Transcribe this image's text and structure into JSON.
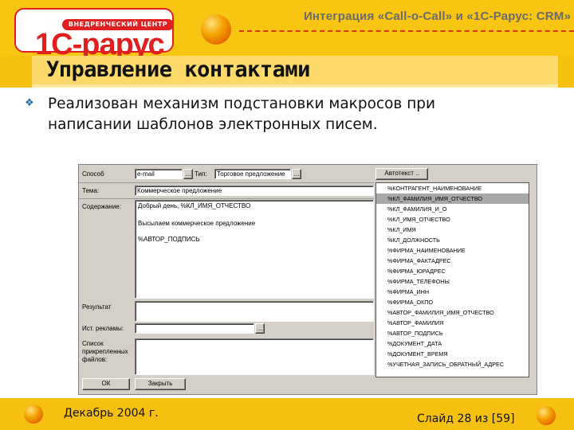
{
  "header": {
    "logo_tag": "ВНЕДРЕНЧЕСКИЙ ЦЕНТР",
    "logo_text": "1С-рарус",
    "title": "Интеграция «Call-o-Call» и «1С-Рарус: CRM»"
  },
  "slide": {
    "title": "Управление контактами",
    "bullet": "Реализован механизм подстановки макросов при написании шаблонов электронных писем."
  },
  "form": {
    "method_label": "Способ",
    "method_value": "e-mail",
    "type_label": "Тип:",
    "type_value": "Торговое предложение",
    "autotext_button": "Автотекст ..",
    "ellipsis": "...",
    "subject_label": "Тема:",
    "subject_value": "Коммерческое предложение",
    "content_label": "Содержание:",
    "body_lines": [
      "Добрый день, %КЛ_ИМЯ_ОТЧЕСТВО",
      "Высылаем коммерческое предложение",
      "%АВТОР_ПОДПИСЬ"
    ],
    "result_label": "Результат",
    "attachments_label": "Ист. рекламы:",
    "files_label": "Список прикрепленных файлов:",
    "ok_button": "ОК",
    "close_button": "Закрыть",
    "macros": [
      "%КОНТРАГЕНТ_НАИМЕНОВАНИЕ",
      "%КЛ_ФАМИЛИЯ_ИМЯ_ОТЧЕСТВО",
      "%КЛ_ФАМИЛИЯ_И_О",
      "%КЛ_ИМЯ_ОТЧЕСТВО",
      "%КЛ_ИМЯ",
      "%КЛ_ДОЛЖНОСТЬ",
      "%ФИРМА_НАИМЕНОВАНИЕ",
      "%ФИРМА_ФАКТАДРЕС",
      "%ФИРМА_ЮРАДРЕС",
      "%ФИРМА_ТЕЛЕФОНЫ",
      "%ФИРМА_ИНН",
      "%ФИРМА_ОКПО",
      "%АВТОР_ФАМИЛИЯ_ИМЯ_ОТЧЕСТВО",
      "%АВТОР_ФАМИЛИЯ",
      "%АВТОР_ПОДПИСЬ",
      "%ДОКУМЕНТ_ДАТА",
      "%ДОКУМЕНТ_ВРЕМЯ",
      "%УЧЕТНАЯ_ЗАПИСЬ_ОБРАТНЫЙ_АДРЕС"
    ],
    "selected_macro_index": 1
  },
  "footer": {
    "date": "Декабрь 2004 г.",
    "slide_number": "Слайд 28 из [59]"
  },
  "colors": {
    "background": "#f5c010",
    "accent_red": "#e02020",
    "bullet": "#2a6ca8"
  }
}
